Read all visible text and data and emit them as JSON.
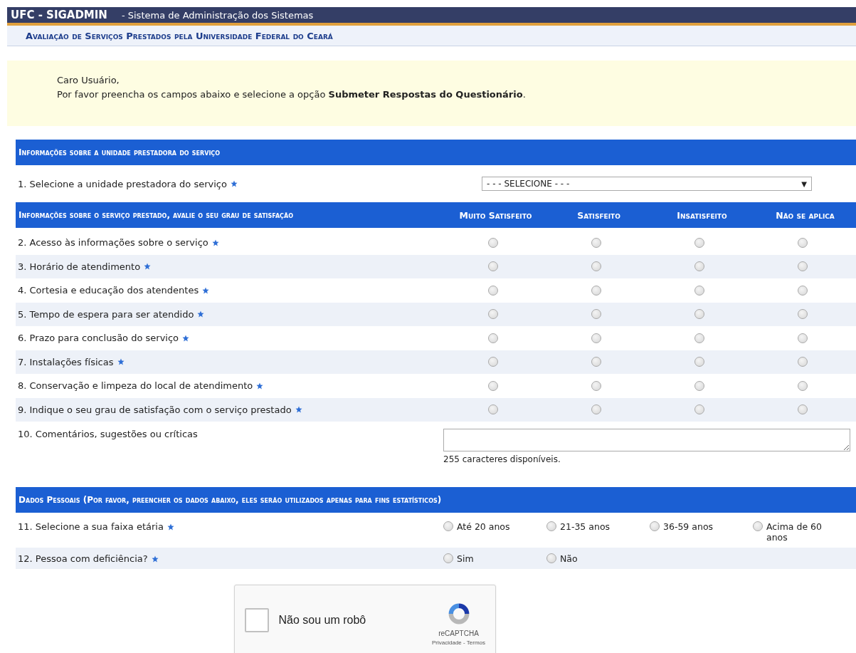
{
  "header": {
    "system": "UFC - SIGADMIN",
    "subtitle": "- Sistema de Administração dos Sistemas"
  },
  "page_title": "Avaliação de Serviços Prestados pela Universidade Federal do Ceará",
  "notice": {
    "greeting": "Caro Usuário,",
    "message": "Por favor preencha os campos abaixo e selecione a opção **Submeter Respostas do Questionário**."
  },
  "unit_section": {
    "title": "Informações sobre a unidade prestadora do serviço",
    "question": {
      "label": "1. Selecione a unidade prestadora do serviço",
      "required": true
    },
    "select": {
      "value": "- - - SELECIONE - - -",
      "arrow": "▼"
    }
  },
  "satisfaction_section": {
    "title": "Informações sobre o serviço prestado, avalie o seu grau de satisfação",
    "columns": [
      "Muito Satisfeito",
      "Satisfeito",
      "Insatisfeito",
      "Não se aplica"
    ],
    "rows": [
      {
        "label": "2. Acesso às informações sobre o serviço",
        "required": true,
        "choices": [
          {
            "selected": false
          },
          {
            "selected": false
          },
          {
            "selected": false
          },
          {
            "selected": false
          }
        ]
      },
      {
        "label": "3. Horário de atendimento",
        "required": true,
        "choices": [
          {
            "selected": false
          },
          {
            "selected": false
          },
          {
            "selected": false
          },
          {
            "selected": false
          }
        ]
      },
      {
        "label": "4. Cortesia e educação dos atendentes",
        "required": true,
        "choices": [
          {
            "selected": false
          },
          {
            "selected": false
          },
          {
            "selected": false
          },
          {
            "selected": false
          }
        ]
      },
      {
        "label": "5. Tempo de espera para ser atendido",
        "required": true,
        "choices": [
          {
            "selected": false
          },
          {
            "selected": false
          },
          {
            "selected": false
          },
          {
            "selected": false
          }
        ]
      },
      {
        "label": "6. Prazo para conclusão do serviço",
        "required": true,
        "choices": [
          {
            "selected": false
          },
          {
            "selected": false
          },
          {
            "selected": false
          },
          {
            "selected": false
          }
        ]
      },
      {
        "label": "7. Instalações físicas",
        "required": true,
        "choices": [
          {
            "selected": false
          },
          {
            "selected": false
          },
          {
            "selected": false
          },
          {
            "selected": false
          }
        ]
      },
      {
        "label": "8. Conservação e limpeza do local de atendimento",
        "required": true,
        "choices": [
          {
            "selected": false
          },
          {
            "selected": false
          },
          {
            "selected": false
          },
          {
            "selected": false
          }
        ]
      },
      {
        "label": "9. Indique o seu grau de satisfação com o serviço prestado",
        "required": true,
        "choices": [
          {
            "selected": false
          },
          {
            "selected": false
          },
          {
            "selected": false
          },
          {
            "selected": false
          }
        ]
      }
    ],
    "comments": {
      "label": "10. Comentários, sugestões ou críticas",
      "required": false,
      "counter": "255 caracteres disponíveis."
    }
  },
  "personal_section": {
    "title": "Dados Pessoais (Por favor, preencher os dados abaixo, eles serão utilizados apenas para fins estatísticos)",
    "rows": [
      {
        "label": "11. Selecione a sua faixa etária",
        "required": true,
        "options": [
          {
            "label": "Até 20 anos",
            "selected": false
          },
          {
            "label": "21-35 anos",
            "selected": false
          },
          {
            "label": "36-59 anos",
            "selected": false
          },
          {
            "label": "Acima de 60 anos",
            "selected": false
          }
        ]
      },
      {
        "label": "12. Pessoa com deficiência?",
        "required": true,
        "options": [
          {
            "label": "Sim",
            "selected": false
          },
          {
            "label": "Não",
            "selected": false
          }
        ]
      }
    ]
  },
  "captcha": {
    "label": "Não sou um robô",
    "checked": false,
    "brand": "reCAPTCHA",
    "links": "Privacidade - Termos"
  }
}
